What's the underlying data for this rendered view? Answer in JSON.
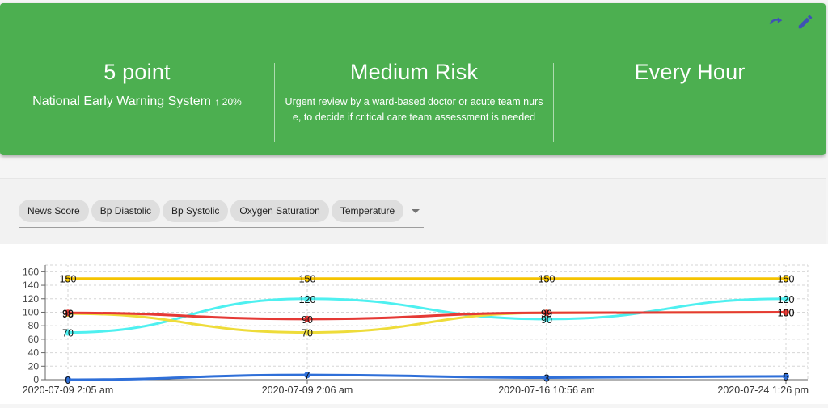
{
  "summary": {
    "score_value": "5 point",
    "score_label": "National Early Warning System",
    "score_trend": "↑ 20%",
    "risk_title": "Medium Risk",
    "risk_description": "Urgent review by a ward-based doctor or acute team nurse, to decide if critical care team assessment is needed",
    "frequency": "Every Hour"
  },
  "toolbar": {
    "icons": [
      "refresh-icon",
      "edit-icon"
    ]
  },
  "chips": [
    "News Score",
    "Bp Diastolic",
    "Bp Systolic",
    "Oxygen Saturation",
    "Temperature"
  ],
  "colors": {
    "banner": "#4caf50",
    "icon": "#3f51b5"
  },
  "chart_data": {
    "type": "line",
    "x": [
      "2020-07-09 2:05 am",
      "2020-07-09 2:06 am",
      "2020-07-16 10:56 am",
      "2020-07-24 1:26 pm"
    ],
    "ylim": [
      0,
      170
    ],
    "yticks": [
      0,
      20,
      40,
      60,
      80,
      100,
      120,
      140,
      160
    ],
    "grid": true,
    "series": [
      {
        "color": "#f5c400",
        "values": [
          150,
          150,
          150,
          150
        ]
      },
      {
        "color": "#4ef0f0",
        "values": [
          70,
          120,
          90,
          120
        ]
      },
      {
        "color": "#eedc3a",
        "values": [
          98,
          70,
          99,
          100
        ]
      },
      {
        "color": "#e53935",
        "values": [
          99,
          90,
          99,
          100
        ]
      },
      {
        "color": "#2f6fd8",
        "values": [
          0,
          7,
          3,
          5
        ]
      }
    ]
  }
}
